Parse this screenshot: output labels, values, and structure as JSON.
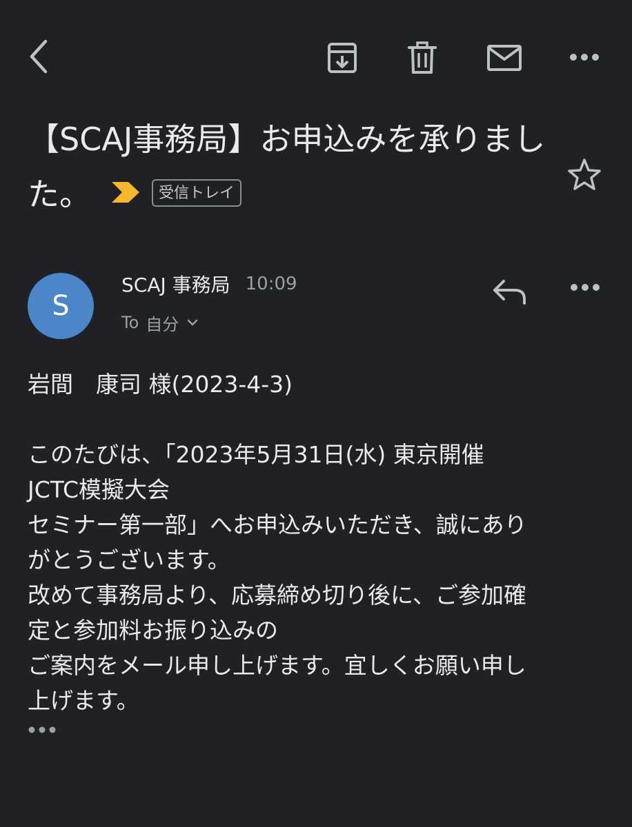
{
  "toolbar": {
    "back_icon": "chevron-left-icon",
    "archive_icon": "archive-icon",
    "delete_icon": "trash-icon",
    "mark_unread_icon": "mail-icon",
    "more_icon": "more-horizontal-icon"
  },
  "subject": {
    "title": "【SCAJ事務局】お申込みを承りました。",
    "importance_marker_color": "#f6b82a",
    "label": "受信トレイ",
    "star_icon": "star-outline-icon"
  },
  "message": {
    "avatar_letter": "S",
    "avatar_color": "#4a86c8",
    "sender": "SCAJ 事務局",
    "time": "10:09",
    "to_label": "To",
    "recipient": "自分",
    "reply_icon": "reply-icon",
    "more_icon": "more-horizontal-icon"
  },
  "body": {
    "lines": [
      "岩間　康司 様(2023-4-3)",
      "",
      "このたびは、「2023年5月31日(水) 東京開催",
      "JCTC模擬大会",
      "セミナー第一部」へお申込みいただき、誠にあり",
      "がとうございます。",
      "改めて事務局より、応募締め切り後に、ご参加確",
      "定と参加料お振り込みの",
      "ご案内をメール申し上げます。宜しくお願い申し",
      "上げます。"
    ]
  }
}
